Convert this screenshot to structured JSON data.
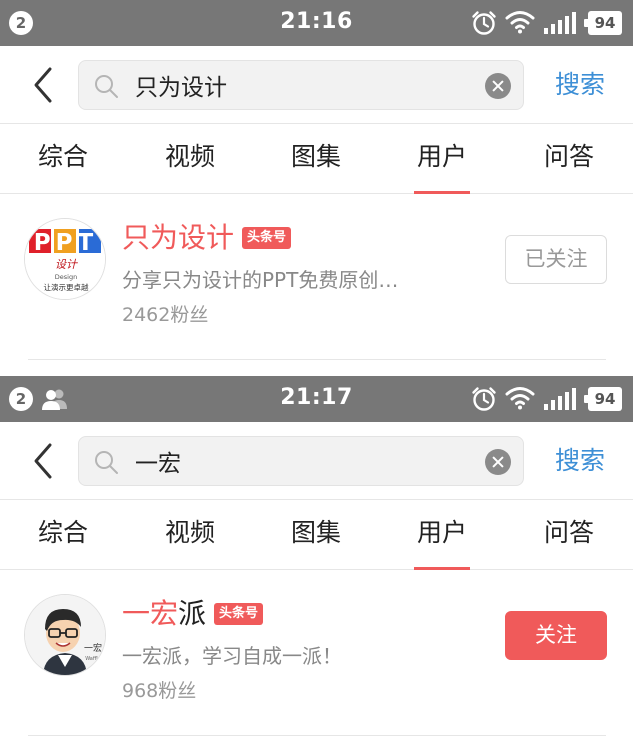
{
  "colors": {
    "status_bar": "#777777",
    "accent_red": "#f05a5a",
    "accent_blue": "#3d8fd6",
    "muted_text": "#888888"
  },
  "screens": [
    {
      "status_bar": {
        "notification_count": "2",
        "show_people_icon": false,
        "time": "21:16",
        "battery": "94",
        "icons": [
          "alarm-icon",
          "wifi-icon",
          "signal-icon",
          "battery-icon"
        ]
      },
      "search": {
        "query": "只为设计",
        "button_label": "搜索",
        "icons": [
          "back-arrow-icon",
          "search-icon",
          "clear-icon"
        ]
      },
      "tabs": [
        {
          "label": "综合",
          "active": false
        },
        {
          "label": "视频",
          "active": false
        },
        {
          "label": "图集",
          "active": false
        },
        {
          "label": "用户",
          "active": true
        },
        {
          "label": "问答",
          "active": false
        }
      ],
      "result": {
        "name_highlight": "只为设计",
        "name_rest": "",
        "badge": "头条号",
        "bio": "分享只为设计的PPT免费原创…",
        "fans": "2462粉丝",
        "follow_label": "已关注",
        "followed": true,
        "avatar": {
          "logo_letters": "PPT",
          "logo_sub": "设计",
          "logo_design": "Design",
          "logo_tagline": "让演示更卓越"
        }
      }
    },
    {
      "status_bar": {
        "notification_count": "2",
        "show_people_icon": true,
        "time": "21:17",
        "battery": "94",
        "icons": [
          "people-icon",
          "alarm-icon",
          "wifi-icon",
          "signal-icon",
          "battery-icon"
        ]
      },
      "search": {
        "query": "一宏",
        "button_label": "搜索",
        "icons": [
          "back-arrow-icon",
          "search-icon",
          "clear-icon"
        ]
      },
      "tabs": [
        {
          "label": "综合",
          "active": false
        },
        {
          "label": "视频",
          "active": false
        },
        {
          "label": "图集",
          "active": false
        },
        {
          "label": "用户",
          "active": true
        },
        {
          "label": "问答",
          "active": false
        }
      ],
      "result": {
        "name_highlight": "一宏",
        "name_rest": "派",
        "badge": "头条号",
        "bio": "一宏派，学习自成一派！",
        "fans": "968粉丝",
        "follow_label": "关注",
        "followed": false,
        "avatar": {
          "caption": "一宏",
          "caption_sub": "Waffle"
        }
      }
    }
  ]
}
